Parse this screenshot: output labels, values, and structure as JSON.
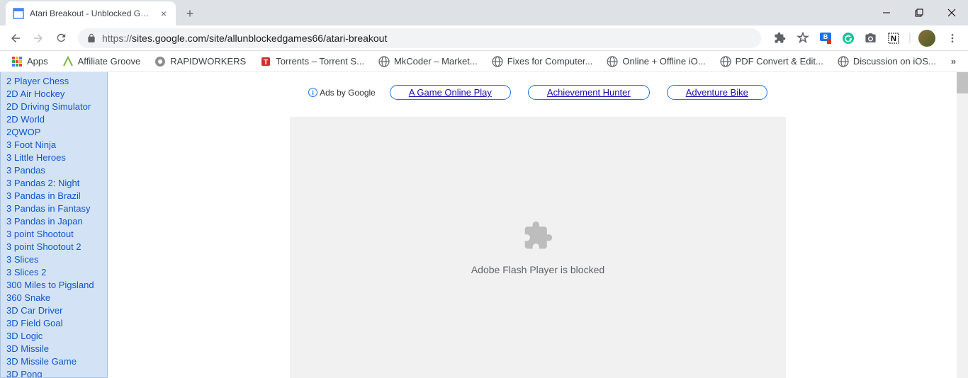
{
  "tab": {
    "title": "Atari Breakout - Unblocked Games"
  },
  "url": {
    "protocol": "https://",
    "rest": "sites.google.com/site/allunblockedgames66/atari-breakout"
  },
  "bookmarks": [
    {
      "label": "Apps",
      "icon": "apps"
    },
    {
      "label": "Affiliate Groove",
      "icon": "groove"
    },
    {
      "label": "RAPIDWORKERS",
      "icon": "rapid"
    },
    {
      "label": "Torrents – Torrent S...",
      "icon": "torrent"
    },
    {
      "label": "MkCoder – Market...",
      "icon": "globe"
    },
    {
      "label": "Fixes for Computer...",
      "icon": "globe"
    },
    {
      "label": "Online + Offline iO...",
      "icon": "globe"
    },
    {
      "label": "PDF Convert & Edit...",
      "icon": "globe"
    },
    {
      "label": "Discussion on iOS...",
      "icon": "globe"
    }
  ],
  "sidebar": [
    "2 Player Chess",
    "2D Air Hockey",
    "2D Driving Simulator",
    "2D World",
    "2QWOP",
    "3 Foot Ninja",
    "3 Little Heroes",
    "3 Pandas",
    "3 Pandas 2: Night",
    "3 Pandas in Brazil",
    "3 Pandas in Fantasy",
    "3 Pandas in Japan",
    "3 point Shootout",
    "3 point Shootout 2",
    "3 Slices",
    "3 Slices 2",
    "300 Miles to Pigsland",
    "360 Snake",
    "3D Car Driver",
    "3D Field Goal",
    "3D Logic",
    "3D Missile",
    "3D Missile Game",
    "3D Pong"
  ],
  "ads": {
    "label": "Ads by Google",
    "links": [
      "A Game Online Play",
      "Achievement Hunter",
      "Adventure Bike"
    ]
  },
  "flash": {
    "message": "Adobe Flash Player is blocked"
  }
}
